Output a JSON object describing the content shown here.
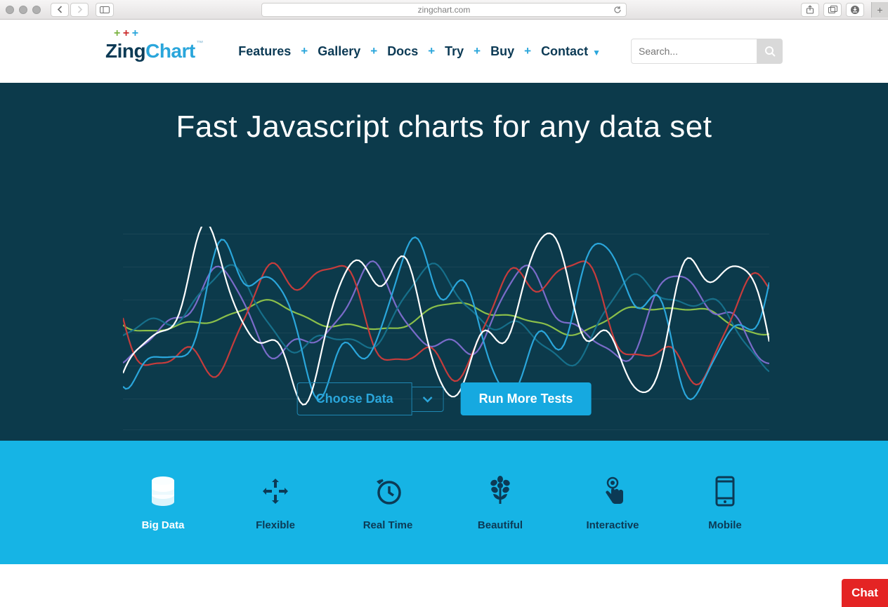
{
  "browser": {
    "url": "zingchart.com"
  },
  "logo": {
    "part1": "Zing",
    "part2": "Chart",
    "tm": "™"
  },
  "nav": {
    "items": [
      "Features",
      "Gallery",
      "Docs",
      "Try",
      "Buy",
      "Contact"
    ]
  },
  "search": {
    "placeholder": "Search..."
  },
  "hero": {
    "headline": "Fast Javascript charts for any data set",
    "choose_data_label": "Choose Data",
    "run_tests_label": "Run More Tests"
  },
  "features": {
    "items": [
      {
        "label": "Big Data",
        "icon": "database-icon",
        "active": true
      },
      {
        "label": "Flexible",
        "icon": "arrows-icon",
        "active": false
      },
      {
        "label": "Real Time",
        "icon": "clock-icon",
        "active": false
      },
      {
        "label": "Beautiful",
        "icon": "flower-icon",
        "active": false
      },
      {
        "label": "Interactive",
        "icon": "touch-icon",
        "active": false
      },
      {
        "label": "Mobile",
        "icon": "mobile-icon",
        "active": false
      }
    ]
  },
  "chat": {
    "label": "Chat"
  },
  "chart_colors": {
    "red": "#c63c3c",
    "blue": "#2aa6db",
    "teal": "#166f8a",
    "purple": "#7a6bc9",
    "white": "#ffffff",
    "green": "#8bbf4a"
  }
}
